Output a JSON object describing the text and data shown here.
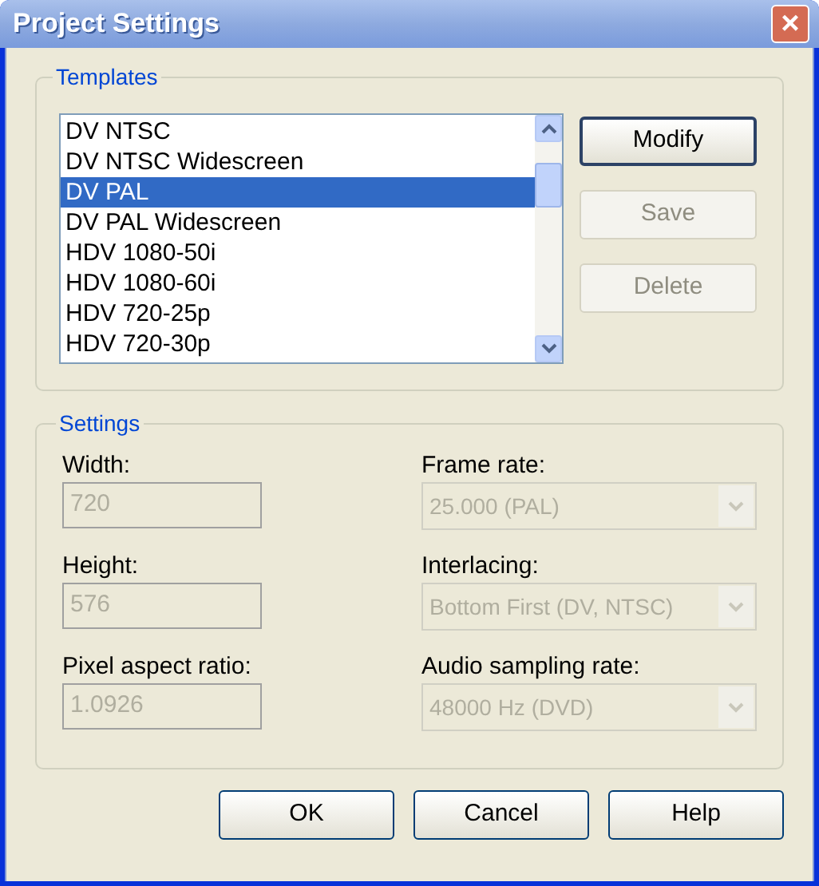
{
  "window": {
    "title": "Project Settings",
    "close": "×"
  },
  "templates": {
    "title": "Templates",
    "items": [
      {
        "label": "DV NTSC",
        "selected": false
      },
      {
        "label": "DV NTSC Widescreen",
        "selected": false
      },
      {
        "label": "DV PAL",
        "selected": true
      },
      {
        "label": "DV PAL Widescreen",
        "selected": false
      },
      {
        "label": "HDV 1080-50i",
        "selected": false
      },
      {
        "label": "HDV 1080-60i",
        "selected": false
      },
      {
        "label": "HDV 720-25p",
        "selected": false
      },
      {
        "label": "HDV 720-30p",
        "selected": false
      }
    ],
    "buttons": [
      {
        "label": "Modify",
        "disabled": false
      },
      {
        "label": "Save",
        "disabled": true
      },
      {
        "label": "Delete",
        "disabled": true
      }
    ]
  },
  "settings": {
    "title": "Settings",
    "fields": [
      {
        "label": "Width:",
        "value": "720",
        "disabled": true
      },
      {
        "label": "Height:",
        "value": "576",
        "disabled": true
      },
      {
        "label": "Pixel aspect ratio:",
        "value": "1.0926",
        "disabled": true
      }
    ],
    "dropdowns": [
      {
        "label": "Frame rate:",
        "value": "25.000 (PAL)",
        "disabled": true
      },
      {
        "label": "Interlacing:",
        "value": "Bottom First (DV, NTSC)",
        "disabled": true
      },
      {
        "label": "Audio sampling rate:",
        "value": "48000 Hz (DVD)",
        "disabled": true
      }
    ]
  },
  "buttons": [
    {
      "label": "OK"
    },
    {
      "label": "Cancel"
    },
    {
      "label": "Help"
    }
  ]
}
